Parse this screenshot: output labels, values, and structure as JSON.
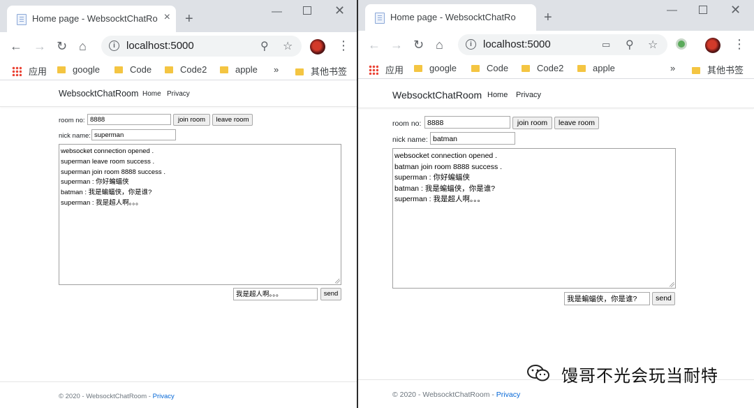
{
  "windows": [
    {
      "tab_title": "Home page - WebsocktChatRoom",
      "address": "localhost:5000",
      "bookmarks": [
        "应用",
        "google",
        "Code",
        "Code2",
        "apple",
        "»",
        "其他书签"
      ],
      "brand": "WebsocktChatRoom",
      "nav": [
        "Home",
        "Privacy"
      ],
      "room_label": "room no:",
      "room_value": "8888",
      "join_label": "join room",
      "leave_label": "leave room",
      "nick_label": "nick name:",
      "nick_value": "superman",
      "messages": [
        "websocket connection opened .",
        "superman leave room  success .",
        "superman join room 8888 success .",
        "superman : 你好蝙蝠侠",
        "batman : 我是蝙蝠侠，你是谁?",
        "superman : 我是超人啊。。。"
      ],
      "send_value": "我是超人啊。。。",
      "send_label": "send",
      "footer_text": "© 2020 - WebsocktChatRoom - ",
      "footer_link": "Privacy"
    },
    {
      "tab_title": "Home page - WebsocktChatRoom",
      "address": "localhost:5000",
      "bookmarks": [
        "应用",
        "google",
        "Code",
        "Code2",
        "apple",
        "»",
        "其他书签"
      ],
      "brand": "WebsocktChatRoom",
      "nav": [
        "Home",
        "Privacy"
      ],
      "room_label": "room no:",
      "room_value": "8888",
      "join_label": "join room",
      "leave_label": "leave room",
      "nick_label": "nick name:",
      "nick_value": "batman",
      "messages": [
        "websocket connection opened .",
        "batman join room 8888 success .",
        "superman : 你好蝙蝠侠",
        "batman : 我是蝙蝠侠，你是谁?",
        "superman : 我是超人啊。。。"
      ],
      "send_value": "我是蝙蝠侠，你是谁?",
      "send_label": "send",
      "footer_text": "© 2020 - WebsocktChatRoom - ",
      "footer_link": "Privacy"
    }
  ],
  "watermark": "馒哥不光会玩当耐特"
}
